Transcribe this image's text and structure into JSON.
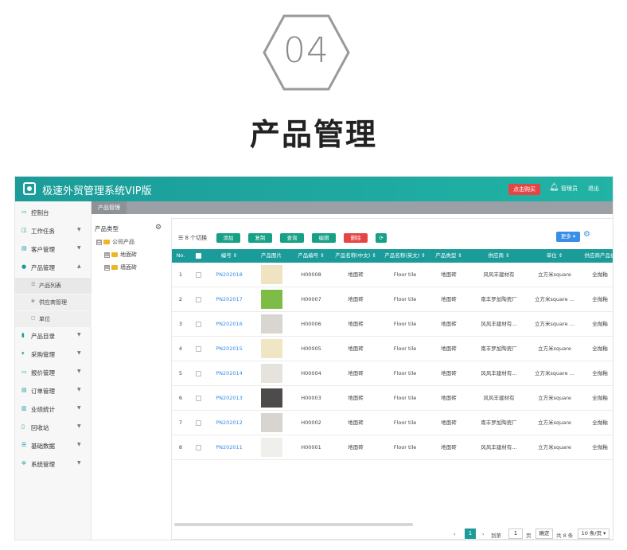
{
  "hero": {
    "number": "04",
    "title": "产品管理"
  },
  "topbar": {
    "title": "极速外贸管理系统VIP版",
    "notice_label": "点击购买",
    "user_label": "管理员",
    "logout_label": "退出"
  },
  "sidebar": {
    "items": [
      {
        "icon": "monitor-icon",
        "label": "控制台",
        "arrow": ""
      },
      {
        "icon": "task-icon",
        "label": "工作任务",
        "arrow": "▼"
      },
      {
        "icon": "customer-icon",
        "label": "客户管理",
        "arrow": "▼"
      },
      {
        "icon": "product-icon",
        "label": "产品管理",
        "arrow": "▲"
      },
      {
        "icon": "catalog-icon",
        "label": "产品目录",
        "arrow": "▼"
      },
      {
        "icon": "purchase-icon",
        "label": "采购管理",
        "arrow": "▼"
      },
      {
        "icon": "quote-icon",
        "label": "报价管理",
        "arrow": "▼"
      },
      {
        "icon": "order-icon",
        "label": "订单管理",
        "arrow": "▼"
      },
      {
        "icon": "stats-icon",
        "label": "业绩统计",
        "arrow": "▼"
      },
      {
        "icon": "recycle-icon",
        "label": "回收站",
        "arrow": "▼"
      },
      {
        "icon": "base-data-icon",
        "label": "基础数据",
        "arrow": "▼"
      },
      {
        "icon": "settings-icon",
        "label": "系统管理",
        "arrow": "▼"
      }
    ],
    "subitems": [
      {
        "icon": "list-icon",
        "label": "产品列表"
      },
      {
        "icon": "supplier-icon",
        "label": "供应商管理"
      },
      {
        "icon": "unit-icon",
        "label": "单位"
      }
    ]
  },
  "tabbar": {
    "active_tab": "产品管理"
  },
  "tree": {
    "header": "产品类型",
    "nodes": [
      {
        "label": "公司产品",
        "toggle": "⊟"
      },
      {
        "label": "地面砖",
        "toggle": "⊞"
      },
      {
        "label": "墙面砖",
        "toggle": "⊞"
      }
    ]
  },
  "toolbar": {
    "count_label": "☰ 8 个切换",
    "buttons": [
      {
        "label": "添加",
        "color": "#16a085"
      },
      {
        "label": "复制",
        "color": "#16a085"
      },
      {
        "label": "查询",
        "color": "#16a085"
      },
      {
        "label": "编辑",
        "color": "#16a085"
      },
      {
        "label": "删除",
        "color": "#e64545"
      },
      {
        "label": "⟳",
        "color": "#16a085"
      }
    ],
    "export_label": "更多 ▾"
  },
  "table": {
    "columns": [
      "No.",
      "",
      "编号 ⇕",
      "产品图片",
      "产品编号 ⇕",
      "产品名称(中文) ⇕",
      "产品名称(英文) ⇕",
      "产品类型 ⇕",
      "供应商 ⇕",
      "单位 ⇕",
      "供应商产品价"
    ],
    "rows": [
      {
        "no": "1",
        "code": "PN202018",
        "image_color": "#efe3c2",
        "sku": "H00008",
        "name_cn": "地面砖",
        "name_en": "Floor tile",
        "type": "地面砖",
        "supplier": "风风丰建材有",
        "unit": "立方米square",
        "price": "全抛釉"
      },
      {
        "no": "2",
        "code": "PN202017",
        "image_color": "#7dbd45",
        "sku": "H00007",
        "name_cn": "地面砖",
        "name_en": "Floor tile",
        "type": "地面砖",
        "supplier": "南丰罗加陶瓷厂",
        "unit": "立方米square ...",
        "price": "全抛釉"
      },
      {
        "no": "3",
        "code": "PN202016",
        "image_color": "#d9d6d2",
        "sku": "H00006",
        "name_cn": "地面砖",
        "name_en": "Floor tile",
        "type": "地面砖",
        "supplier": "风风丰建材有...",
        "unit": "立方米square ...",
        "price": "全抛釉"
      },
      {
        "no": "4",
        "code": "PN202015",
        "image_color": "#f0e5c4",
        "sku": "H00005",
        "name_cn": "地面砖",
        "name_en": "Floor tile",
        "type": "地面砖",
        "supplier": "南丰罗加陶瓷厂",
        "unit": "立方米square",
        "price": "全抛釉"
      },
      {
        "no": "5",
        "code": "PN202014",
        "image_color": "#e6e3dc",
        "sku": "H00004",
        "name_cn": "地面砖",
        "name_en": "Floor tile",
        "type": "地面砖",
        "supplier": "风风丰建材有...",
        "unit": "立方米square ...",
        "price": "全抛釉"
      },
      {
        "no": "6",
        "code": "PN202013",
        "image_color": "#4e4c4a",
        "sku": "H00003",
        "name_cn": "地面砖",
        "name_en": "Floor tile",
        "type": "地面砖",
        "supplier": "风风丰建材有",
        "unit": "立方米square",
        "price": "全抛釉"
      },
      {
        "no": "7",
        "code": "PN202012",
        "image_color": "#d8d4cf",
        "sku": "H00002",
        "name_cn": "地面砖",
        "name_en": "Floor tile",
        "type": "地面砖",
        "supplier": "南丰罗加陶瓷厂",
        "unit": "立方米square",
        "price": "全抛釉"
      },
      {
        "no": "8",
        "code": "PN202011",
        "image_color": "#efefec",
        "sku": "H00001",
        "name_cn": "地面砖",
        "name_en": "Floor tile",
        "type": "地面砖",
        "supplier": "风风丰建材有...",
        "unit": "立方米square",
        "price": "全抛釉"
      }
    ]
  },
  "pagination": {
    "prev": "‹",
    "current": "1",
    "next": "›",
    "goto_label": "到第",
    "page_input": "1",
    "page_unit": "页",
    "go_label": "确定",
    "total_label": "共 8 条",
    "size_label": "10 条/页 ▾"
  },
  "colors": {
    "brand": "#1b9c9a",
    "danger": "#e64545",
    "info": "#3a8ee6"
  }
}
